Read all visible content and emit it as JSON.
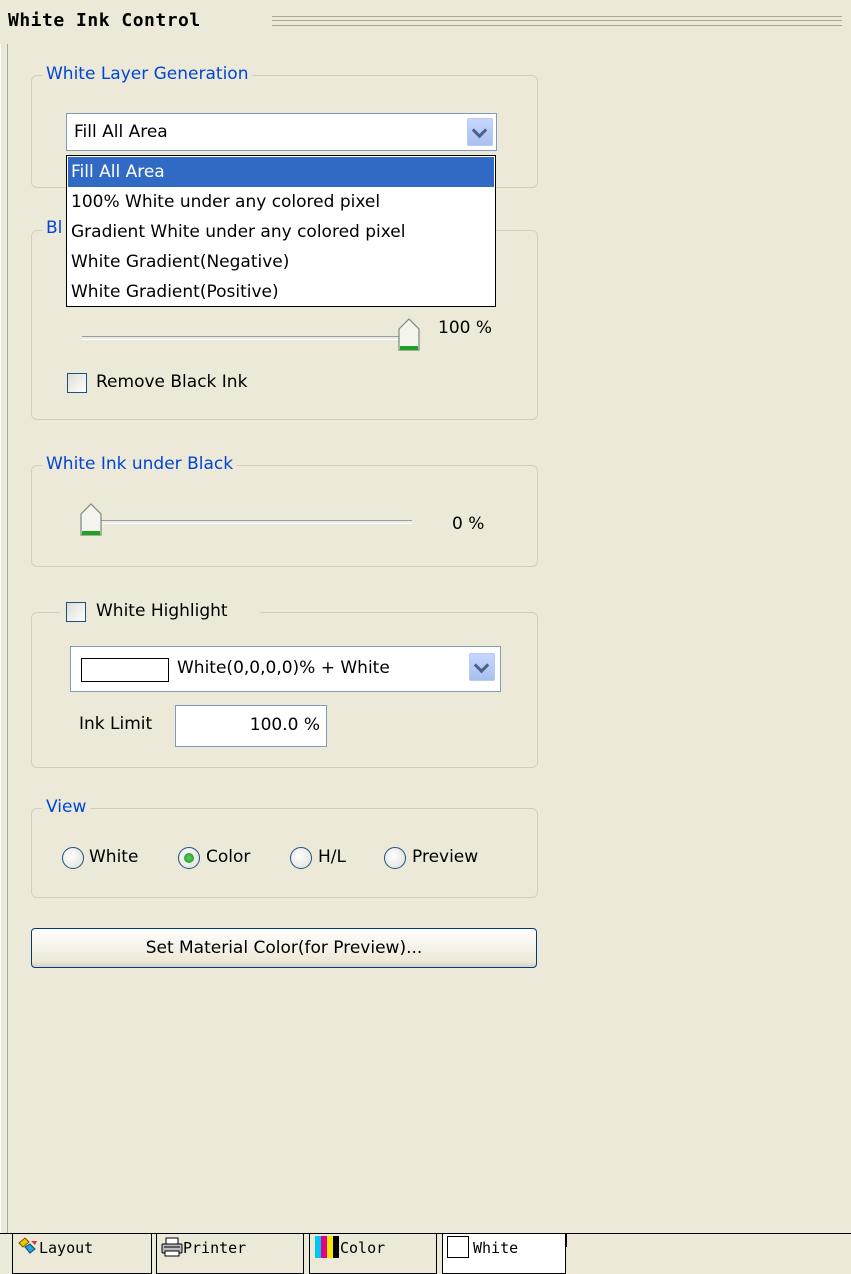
{
  "title": "White Ink Control",
  "white_layer": {
    "legend": "White Layer Generation",
    "selected": "Fill All Area",
    "options": [
      "Fill All Area",
      "100% White under any colored pixel",
      "Gradient White under any colored pixel",
      "White Gradient(Negative)",
      "White Gradient(Positive)"
    ],
    "selected_index": 0
  },
  "black_group": {
    "legend_fragment": "Bl",
    "slider_value": "100 %",
    "slider_fraction": 1.0,
    "remove_black_label": "Remove Black Ink",
    "remove_black_checked": false
  },
  "white_under_black": {
    "legend": "White Ink under Black",
    "slider_value": "0 %",
    "slider_fraction": 0.0
  },
  "white_highlight": {
    "label": "White Highlight",
    "checked": false,
    "combo_value": "White(0,0,0,0)% + White",
    "ink_limit_label": "Ink Limit",
    "ink_limit_value": "100.0 %"
  },
  "view": {
    "legend": "View",
    "options": [
      "White",
      "Color",
      "H/L",
      "Preview"
    ],
    "selected": "Color"
  },
  "set_material_button": "Set Material Color(for Preview)...",
  "tabs": [
    "Layout",
    "Printer",
    "Color",
    "White"
  ],
  "active_tab": "White",
  "colors": {
    "accent_blue": "#0046d5",
    "selection": "#316ac5",
    "face": "#ece9d8"
  }
}
